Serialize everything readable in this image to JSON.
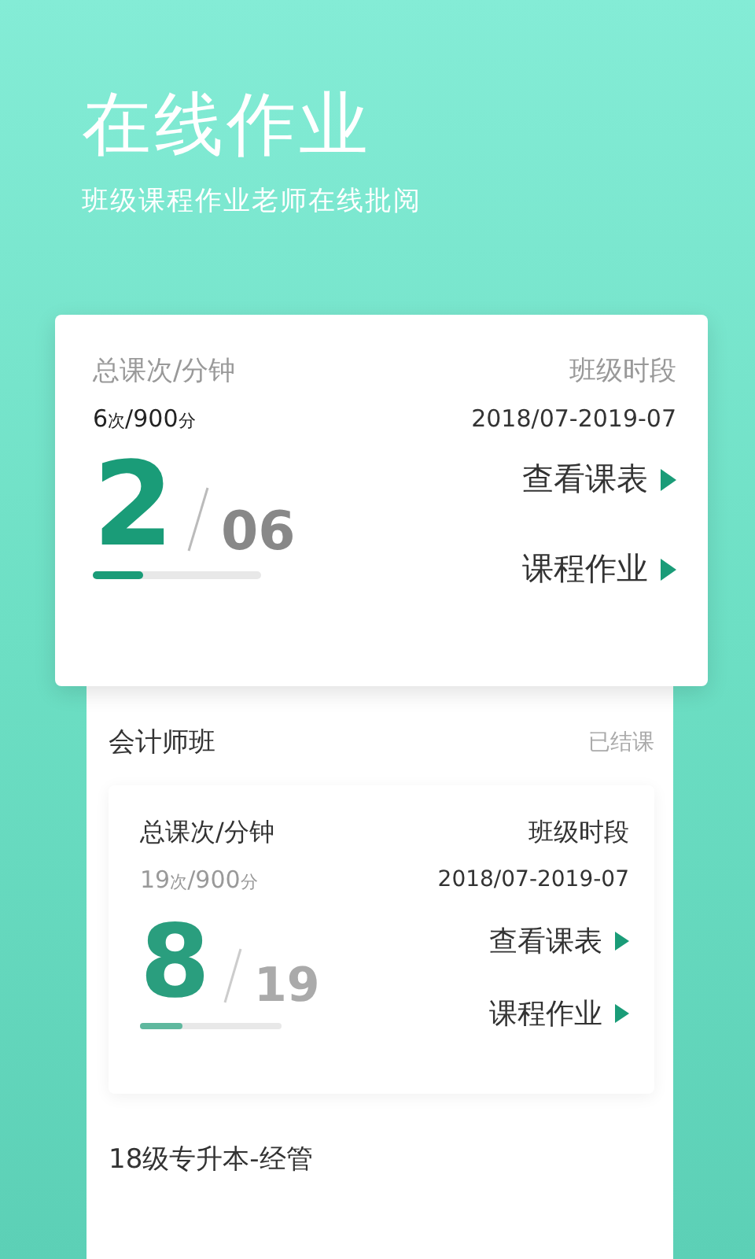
{
  "header": {
    "title": "在线作业",
    "subtitle": "班级课程作业老师在线批阅"
  },
  "featured": {
    "stats_label": "总课次/分钟",
    "stats": [
      {
        "value": "6",
        "unit": "次"
      },
      {
        "value": "900",
        "unit": "分"
      }
    ],
    "separator": "/",
    "period_label": "班级时段",
    "period": "2018/07-2019-07",
    "done": "2",
    "total": "06",
    "level": 0.3,
    "links": [
      "查看课表",
      "课程作业"
    ]
  },
  "classes": [
    {
      "name": "会计师班",
      "status": "已结课",
      "card": {
        "stats_label": "总课次/分钟",
        "stats": [
          {
            "value": "19",
            "unit": "次"
          },
          {
            "value": "900",
            "unit": "分"
          }
        ],
        "separator": "/",
        "period_label": "班级时段",
        "period": "2018/07-2019-07",
        "done": "8",
        "total": "19",
        "level": 0.3,
        "links": [
          "查看课表",
          "课程作业"
        ]
      }
    },
    {
      "name": "18级专升本-经管"
    }
  ]
}
